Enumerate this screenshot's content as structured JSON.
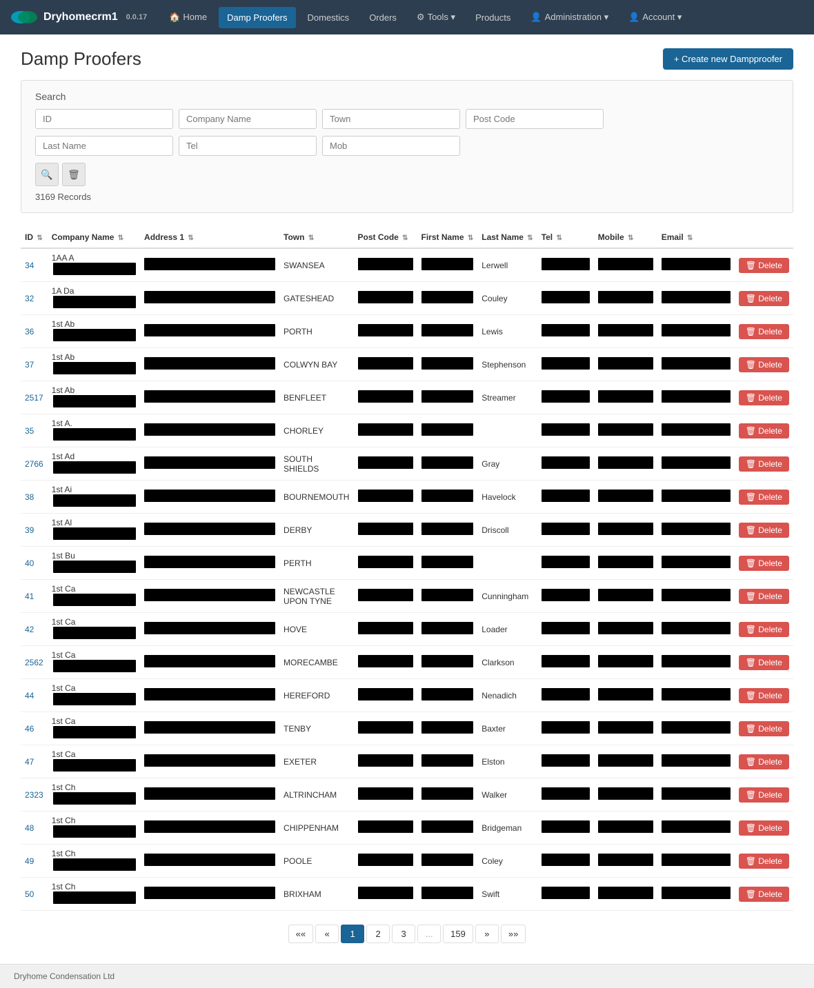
{
  "app": {
    "name": "Dryhomecrm1",
    "version": "0.0.17",
    "footer": "Dryhome Condensation Ltd"
  },
  "navbar": {
    "home_label": "Home",
    "damp_proofers_label": "Damp Proofers",
    "domestics_label": "Domestics",
    "orders_label": "Orders",
    "tools_label": "Tools",
    "products_label": "Products",
    "administration_label": "Administration",
    "account_label": "Account"
  },
  "page": {
    "title": "Damp Proofers",
    "create_btn": "+ Create new Dampproofer"
  },
  "search": {
    "label": "Search",
    "id_placeholder": "ID",
    "company_placeholder": "Company Name",
    "town_placeholder": "Town",
    "postcode_placeholder": "Post Code",
    "lastname_placeholder": "Last Name",
    "tel_placeholder": "Tel",
    "mob_placeholder": "Mob",
    "records_count": "3169 Records"
  },
  "table": {
    "headers": [
      {
        "key": "id",
        "label": "ID"
      },
      {
        "key": "company",
        "label": "Company Name"
      },
      {
        "key": "address",
        "label": "Address 1"
      },
      {
        "key": "town",
        "label": "Town"
      },
      {
        "key": "postcode",
        "label": "Post Code"
      },
      {
        "key": "firstname",
        "label": "First Name"
      },
      {
        "key": "lastname",
        "label": "Last Name"
      },
      {
        "key": "tel",
        "label": "Tel"
      },
      {
        "key": "mobile",
        "label": "Mobile"
      },
      {
        "key": "email",
        "label": "Email"
      },
      {
        "key": "action",
        "label": ""
      }
    ],
    "rows": [
      {
        "id": "34",
        "company": "1AA A",
        "town": "SWANSEA",
        "lastname": "Lerwell",
        "redacted": true
      },
      {
        "id": "32",
        "company": "1A Da",
        "town": "GATESHEAD",
        "lastname": "Couley",
        "redacted": true
      },
      {
        "id": "36",
        "company": "1st Ab",
        "town": "PORTH",
        "lastname": "Lewis",
        "redacted": true
      },
      {
        "id": "37",
        "company": "1st Ab",
        "town": "COLWYN BAY",
        "lastname": "Stephenson",
        "redacted": true
      },
      {
        "id": "2517",
        "company": "1st Ab",
        "town": "BENFLEET",
        "lastname": "Streamer",
        "redacted": true
      },
      {
        "id": "35",
        "company": "1st A.",
        "town": "CHORLEY",
        "lastname": "",
        "redacted": true
      },
      {
        "id": "2766",
        "company": "1st Ad",
        "town": "SOUTH SHIELDS",
        "lastname": "Gray",
        "redacted": true
      },
      {
        "id": "38",
        "company": "1st Ai",
        "town": "BOURNEMOUTH",
        "lastname": "Havelock",
        "redacted": true
      },
      {
        "id": "39",
        "company": "1st Al",
        "town": "DERBY",
        "lastname": "Driscoll",
        "redacted": true
      },
      {
        "id": "40",
        "company": "1st Bu",
        "town": "PERTH",
        "lastname": "",
        "redacted": true
      },
      {
        "id": "41",
        "company": "1st Ca",
        "town": "NEWCASTLE UPON TYNE",
        "lastname": "Cunningham",
        "redacted": true
      },
      {
        "id": "42",
        "company": "1st Ca",
        "town": "HOVE",
        "lastname": "Loader",
        "redacted": true
      },
      {
        "id": "2562",
        "company": "1st Ca",
        "town": "MORECAMBE",
        "lastname": "Clarkson",
        "redacted": true
      },
      {
        "id": "44",
        "company": "1st Ca",
        "town": "HEREFORD",
        "lastname": "Nenadich",
        "redacted": true
      },
      {
        "id": "46",
        "company": "1st Ca",
        "town": "TENBY",
        "lastname": "Baxter",
        "redacted": true
      },
      {
        "id": "47",
        "company": "1st Ca",
        "town": "EXETER",
        "lastname": "Elston",
        "redacted": true
      },
      {
        "id": "2323",
        "company": "1st Ch",
        "town": "ALTRINCHAM",
        "lastname": "Walker",
        "redacted": true
      },
      {
        "id": "48",
        "company": "1st Ch",
        "town": "CHIPPENHAM",
        "lastname": "Bridgeman",
        "redacted": true
      },
      {
        "id": "49",
        "company": "1st Ch",
        "town": "POOLE",
        "lastname": "Coley",
        "redacted": true
      },
      {
        "id": "50",
        "company": "1st Ch",
        "town": "BRIXHAM",
        "lastname": "Swift",
        "redacted": true
      }
    ],
    "delete_label": "Delete"
  },
  "pagination": {
    "first": "««",
    "prev": "«",
    "page1": "1",
    "page2": "2",
    "page3": "3",
    "ellipsis": "...",
    "last_page": "159",
    "next": "»",
    "last": "»»"
  }
}
